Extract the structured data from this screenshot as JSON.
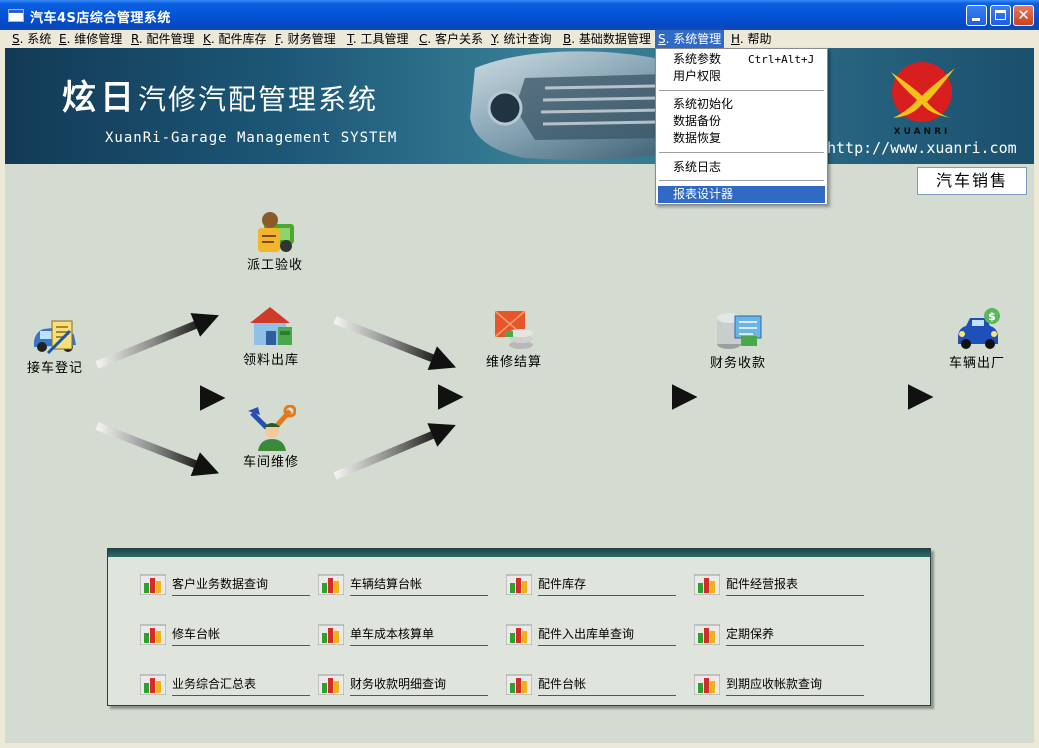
{
  "window": {
    "title": "汽车4S店综合管理系统",
    "close_glyph": "✕"
  },
  "menubar": [
    {
      "key": "S",
      "label": ". 系统"
    },
    {
      "key": "E",
      "label": ". 维修管理"
    },
    {
      "key": "R",
      "label": ". 配件管理"
    },
    {
      "key": "K",
      "label": ". 配件库存"
    },
    {
      "key": "F",
      "label": ". 财务管理"
    },
    {
      "key": "T",
      "label": ". 工具管理"
    },
    {
      "key": "C",
      "label": ". 客户关系"
    },
    {
      "key": "Y",
      "label": ". 统计查询"
    },
    {
      "key": "B",
      "label": ". 基础数据管理"
    },
    {
      "key": "S",
      "label": ". 系统管理"
    },
    {
      "key": "H",
      "label": ". 帮助"
    }
  ],
  "dropdown": {
    "items": [
      {
        "label": "系统参数",
        "shortcut": "Ctrl+Alt+J"
      },
      {
        "label": "用户权限"
      },
      {
        "label": "系统初始化"
      },
      {
        "label": "数据备份"
      },
      {
        "label": "数据恢复"
      },
      {
        "label": "系统日志"
      },
      {
        "label": "报表设计器"
      }
    ]
  },
  "banner": {
    "title_big": "炫日",
    "title_rest": "汽修汽配管理系统",
    "subtitle": "XuanRi-Garage Management SYSTEM",
    "url": "http://www.xuanri.com",
    "logo_text": "XUANRI"
  },
  "sales_button": "汽车销售",
  "workflow": {
    "register": "接车登记",
    "dispatch": "派工验收",
    "parts_out": "领料出库",
    "workshop": "车间维修",
    "settle": "维修结算",
    "finance": "财务收款",
    "exit": "车辆出厂"
  },
  "reports": [
    "客户业务数据查询",
    "车辆结算台帐",
    "配件库存",
    "配件经营报表",
    "修车台帐",
    "单车成本核算单",
    "配件入出库单查询",
    "定期保养",
    "业务综合汇总表",
    "财务收款明细查询",
    "配件台帐",
    "到期应收帐款查询"
  ],
  "colors": {
    "menu_highlight": "#316ac5",
    "banner": "#1d5878",
    "desktop": "#d4dbd0"
  }
}
